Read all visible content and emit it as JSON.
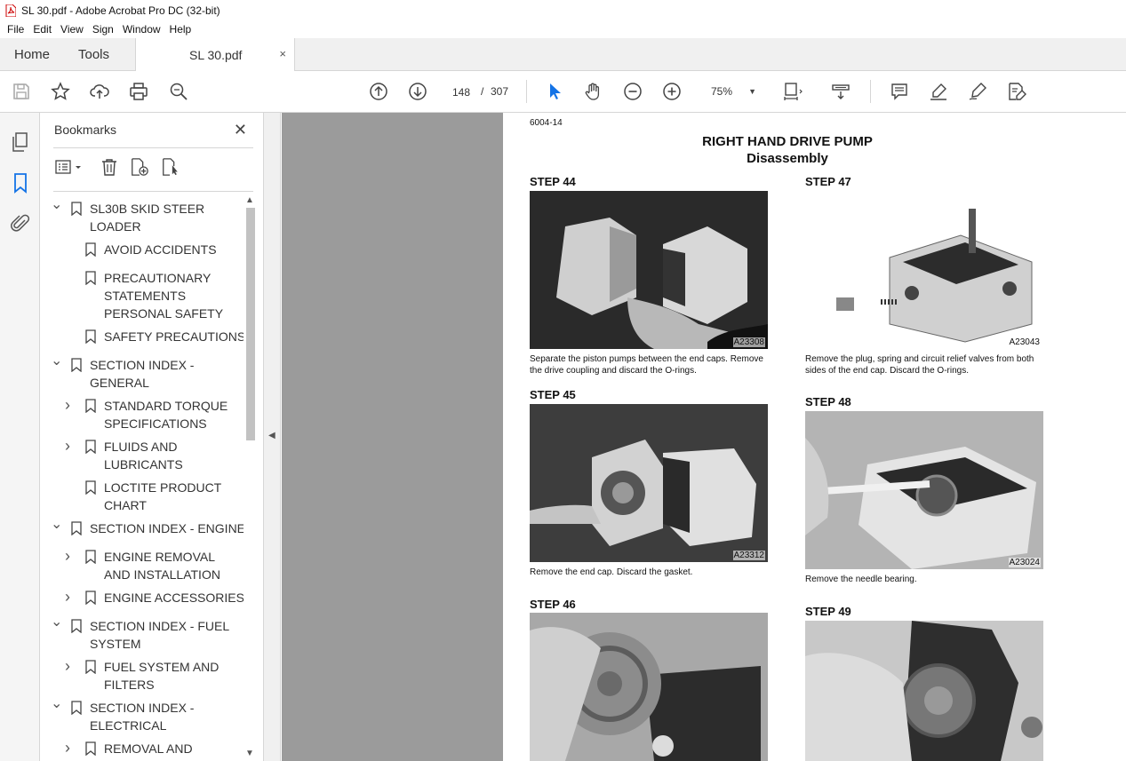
{
  "window": {
    "title": "SL 30.pdf - Adobe Acrobat Pro DC (32-bit)"
  },
  "menu": [
    "File",
    "Edit",
    "View",
    "Sign",
    "Window",
    "Help"
  ],
  "tabs": {
    "home": "Home",
    "tools": "Tools",
    "doc": "SL 30.pdf",
    "close": "×"
  },
  "toolbar": {
    "icons": [
      "save-icon",
      "star-icon",
      "upload-icon",
      "print-icon",
      "search-zoom-icon",
      "page-up-icon",
      "page-down-icon",
      "select-cursor-icon",
      "hand-icon",
      "zoom-out-icon",
      "zoom-in-icon",
      "fit-page-icon",
      "scroll-mode-icon",
      "comment-icon",
      "highlight-icon",
      "sign-icon",
      "edit-pdf-icon"
    ],
    "current_page": "148",
    "separator": "/",
    "total_pages": "307",
    "zoom": "75%"
  },
  "bookmarks": {
    "title": "Bookmarks",
    "close": "✕",
    "items": [
      {
        "label": "SL30B SKID STEER LOADER",
        "lines": [
          "SL30B SKID STEER",
          "LOADER"
        ],
        "level": 0,
        "state": "expanded"
      },
      {
        "label": "AVOID ACCIDENTS",
        "lines": [
          "AVOID ACCIDENTS"
        ],
        "level": 1,
        "state": "leaf"
      },
      {
        "label": "PRECAUTIONARY STATEMENTS PERSONAL SAFETY",
        "lines": [
          "PRECAUTIONARY",
          "STATEMENTS",
          "PERSONAL SAFETY"
        ],
        "level": 1,
        "state": "leaf"
      },
      {
        "label": "SAFETY PRECAUTIONS",
        "lines": [
          "SAFETY PRECAUTIONS"
        ],
        "level": 1,
        "state": "leaf"
      },
      {
        "label": "SECTION INDEX - GENERAL",
        "lines": [
          "SECTION INDEX -",
          "GENERAL"
        ],
        "level": 0,
        "state": "expanded"
      },
      {
        "label": "STANDARD TORQUE SPECIFICATIONS",
        "lines": [
          "STANDARD TORQUE",
          "SPECIFICATIONS"
        ],
        "level": 1,
        "state": "collapsed"
      },
      {
        "label": "FLUIDS AND LUBRICANTS",
        "lines": [
          "FLUIDS AND",
          "LUBRICANTS"
        ],
        "level": 1,
        "state": "collapsed"
      },
      {
        "label": "LOCTITE PRODUCT CHART",
        "lines": [
          "LOCTITE PRODUCT",
          "CHART"
        ],
        "level": 1,
        "state": "leaf"
      },
      {
        "label": "SECTION INDEX - ENGINE",
        "lines": [
          "SECTION INDEX - ENGINE"
        ],
        "level": 0,
        "state": "expanded"
      },
      {
        "label": "ENGINE REMOVAL AND INSTALLATION",
        "lines": [
          "ENGINE REMOVAL",
          "AND INSTALLATION"
        ],
        "level": 1,
        "state": "collapsed"
      },
      {
        "label": "ENGINE ACCESSORIES",
        "lines": [
          "ENGINE ACCESSORIES"
        ],
        "level": 1,
        "state": "collapsed"
      },
      {
        "label": "SECTION INDEX - FUEL SYSTEM",
        "lines": [
          "SECTION INDEX - FUEL",
          "SYSTEM"
        ],
        "level": 0,
        "state": "expanded"
      },
      {
        "label": "FUEL SYSTEM AND FILTERS",
        "lines": [
          "FUEL SYSTEM AND",
          "FILTERS"
        ],
        "level": 1,
        "state": "collapsed"
      },
      {
        "label": "SECTION INDEX - ELECTRICAL",
        "lines": [
          "SECTION INDEX -",
          "ELECTRICAL"
        ],
        "level": 0,
        "state": "expanded"
      },
      {
        "label": "REMOVAL AND",
        "lines": [
          "REMOVAL AND"
        ],
        "level": 1,
        "state": "collapsed"
      }
    ]
  },
  "document": {
    "page_code": "6004-14",
    "title": "RIGHT HAND DRIVE PUMP",
    "subtitle": "Disassembly",
    "steps": [
      {
        "heading": "STEP  44",
        "figure_code": "A23308",
        "caption": "Separate the piston pumps between the end caps. Remove the drive coupling and discard the O-rings."
      },
      {
        "heading": "STEP  45",
        "figure_code": "A23312",
        "caption": "Remove the end cap. Discard the gasket."
      },
      {
        "heading": "STEP  46",
        "figure_code": "",
        "caption": ""
      },
      {
        "heading": "STEP  47",
        "figure_code": "A23043",
        "caption": "Remove the plug, spring and circuit relief valves from both sides of the end cap. Discard the O-rings."
      },
      {
        "heading": "STEP  48",
        "figure_code": "A23024",
        "caption": "Remove the needle bearing."
      },
      {
        "heading": "STEP  49",
        "figure_code": "",
        "caption": ""
      }
    ]
  }
}
